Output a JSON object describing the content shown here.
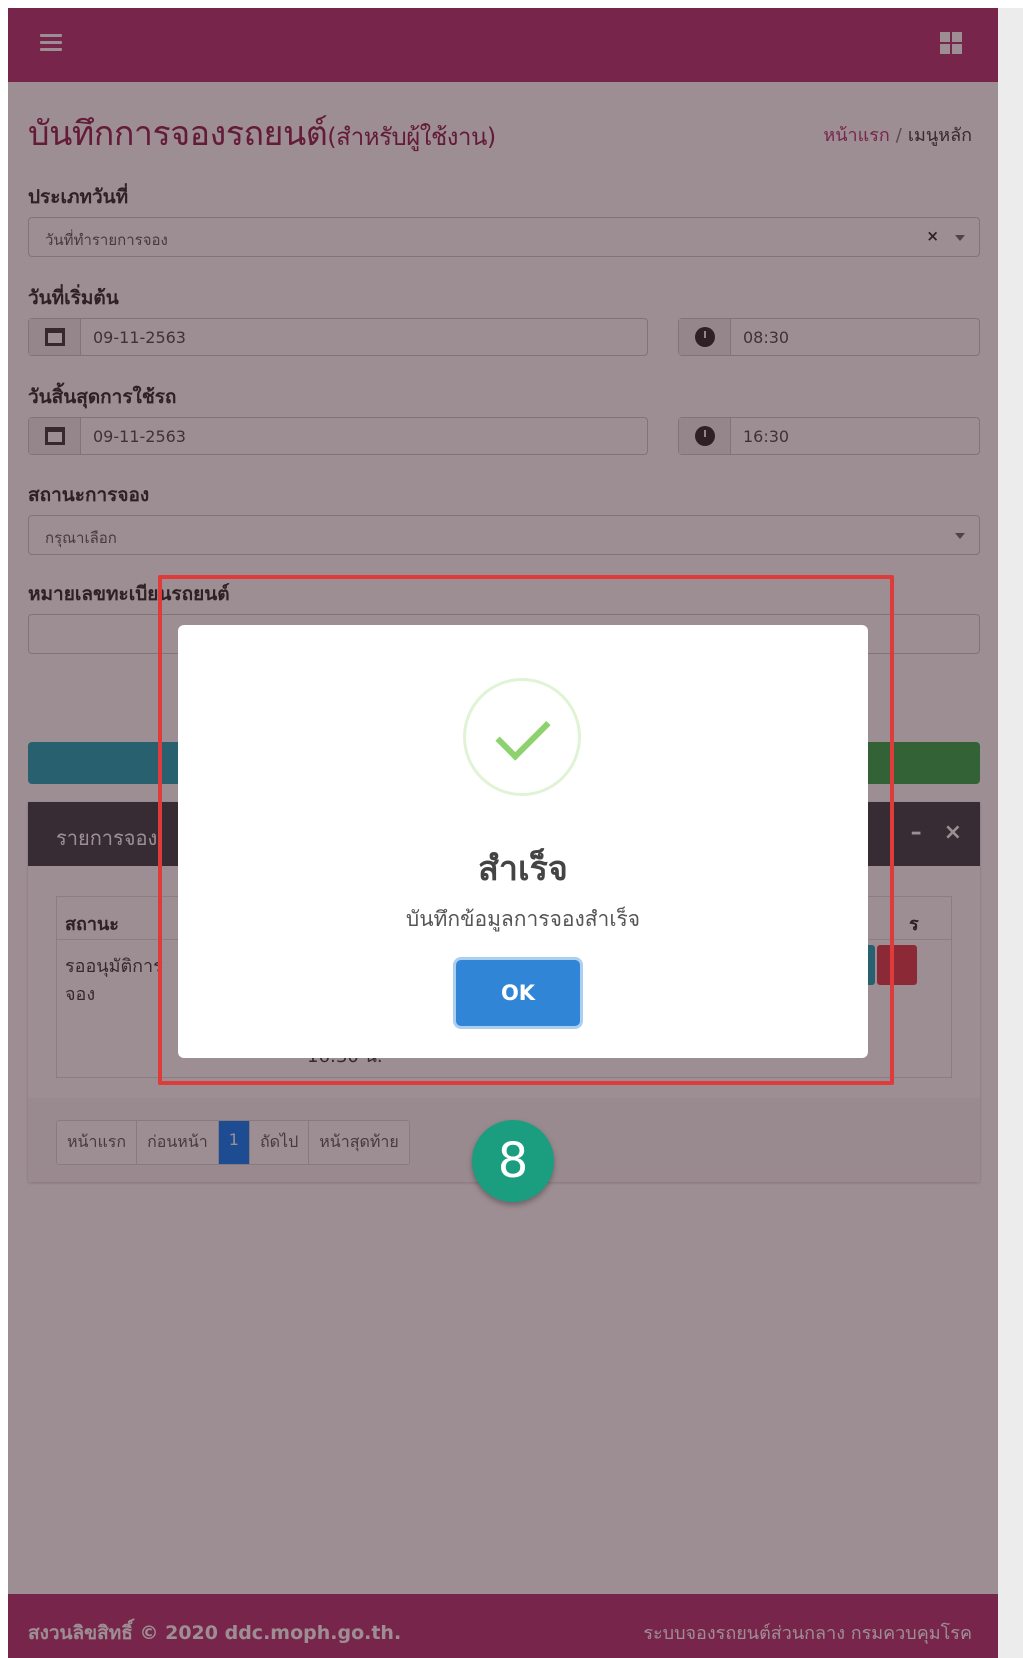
{
  "header": {
    "title": "บันทึกการจองรถยนต์",
    "title_suffix": "(สำหรับผู้ใช้งาน)",
    "breadcrumb_home": "หน้าแรก",
    "breadcrumb_sep": "/",
    "breadcrumb_current": "เมนูหลัก"
  },
  "form": {
    "date_type_label": "ประเภทวันที่",
    "date_type_value": "วันที่ทำรายการจอง",
    "clear_symbol": "×",
    "start_label": "วันที่เริ่มต้น",
    "start_date": "09-11-2563",
    "start_time": "08:30",
    "end_label": "วันสิ้นสุดการใช้รถ",
    "end_date": "09-11-2563",
    "end_time": "16:30",
    "status_label": "สถานะการจอง",
    "status_placeholder": "กรุณาเลือก",
    "plate_label": "หมายเลขทะเบียนรถยนต์"
  },
  "card": {
    "title": "รายการจอง",
    "minimize": "–",
    "close": "×",
    "col_status": "สถานะ",
    "col_manage": "ร",
    "row_status": "รออนุมัติการจอง",
    "row_status_line1": "รออนุมัติการ",
    "row_status_line2": "จอง",
    "row_time": "16:30 น."
  },
  "pager": {
    "first": "หน้าแรก",
    "prev": "ก่อนหน้า",
    "page": "1",
    "next": "ถัดไป",
    "last": "หน้าสุดท้าย"
  },
  "modal": {
    "title": "สำเร็จ",
    "message": "บันทึกข้อมูลการจองสำเร็จ",
    "ok": "OK"
  },
  "step_badge": "8",
  "footer": {
    "copyright": "สงวนลิขสิทธิ์ © 2020 ddc.moph.go.th.",
    "system_name": "ระบบจองรถยนต์ส่วนกลาง กรมควบคุมโรค"
  },
  "colors": {
    "brand": "#b52d6f",
    "ok_button": "#3085d6",
    "highlight": "#e03b3b",
    "step_badge": "#1a9e7f"
  }
}
